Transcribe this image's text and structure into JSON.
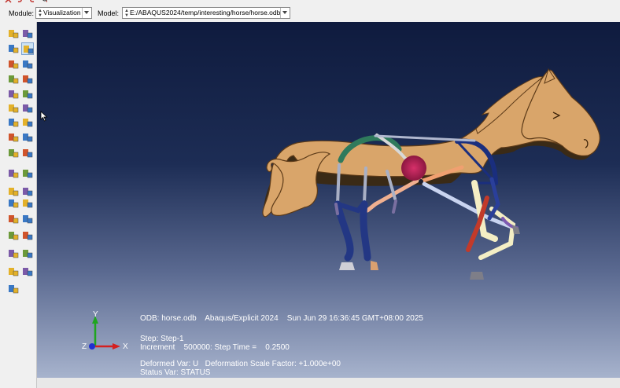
{
  "toolbar": {
    "module_label": "Module:",
    "module_value": "Visualization",
    "model_label": "Model:",
    "model_value": "E:/ABAQUS2024/temp/interesting/horse/horse.odb"
  },
  "viewport": {
    "background_top": "#0f1b3e",
    "background_bottom": "#a7b3cd",
    "horse_body_color": "#d9a56a",
    "info": {
      "odb_line": "ODB: horse.odb    Abaqus/Explicit 2024    Sun Jun 29 16:36:45 GMT+08:00 2025",
      "step_line": "Step: Step-1",
      "increment_line": "Increment    500000: Step Time =    0.2500",
      "deformed_line": "Deformed Var: U   Deformation Scale Factor: +1.000e+00",
      "status_line": "Status Var: STATUS"
    },
    "triad": {
      "x": "X",
      "y": "Y",
      "z": "Z"
    }
  },
  "toolbox_icons": [
    "plot-undeformed-shape-icon",
    "plot-deformed-shape-icon",
    "plot-contours-icon",
    "contour-options-icon",
    "common-options-icon",
    "superimpose-options-icon",
    "plot-symbols-icon",
    "symbol-options-icon",
    "plot-material-orientations-icon",
    "orientation-options-icon",
    "allow-multiple-plot-states-icon",
    "overlay-plot-icon",
    "animate-scale-factor-icon",
    "animate-time-history-icon",
    "animate-harmonic-icon",
    "animation-options-icon",
    "create-xy-data-icon",
    "xy-data-manager-icon",
    "report-field-output-icon",
    "query-information-icon",
    "create-path-icon",
    "plot-xy-curve-icon",
    "free-body-cut-icon",
    "stream-icon",
    "create-display-group-icon",
    "display-group-manager-icon",
    "view-cut-icon",
    "view-cut-manager-icon",
    "odb-display-options-icon",
    "select-frame-icon",
    "field-output-icon",
    "result-options-icon",
    "ply-stack-plot-icon"
  ]
}
